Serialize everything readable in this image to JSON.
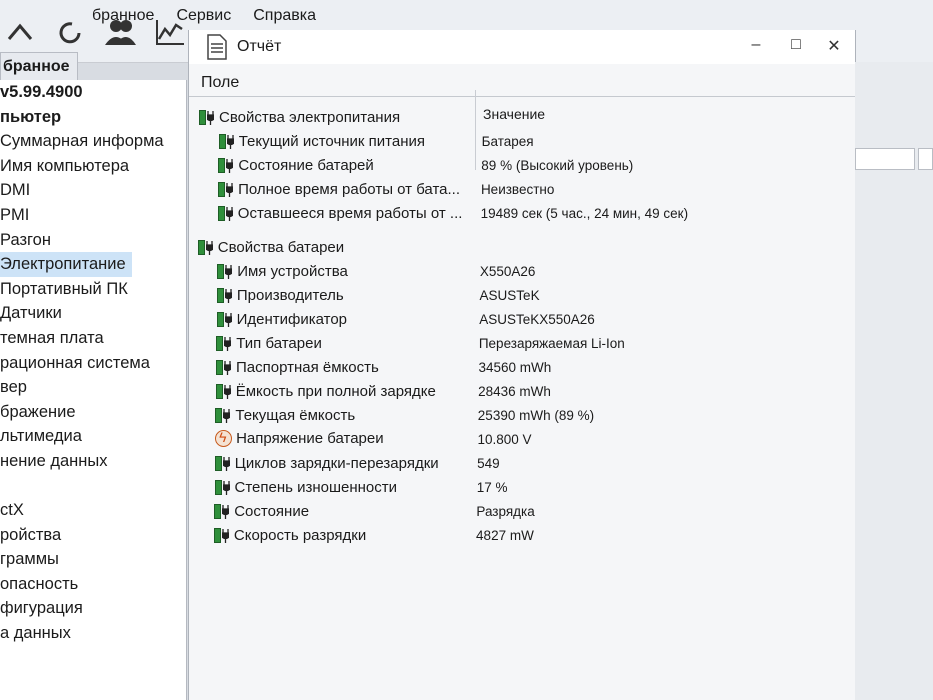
{
  "menu": {
    "favorites_partial": "бранное",
    "service": "Сервис",
    "help": "Справка"
  },
  "toolbar": {
    "icons": [
      "up-arrow-icon",
      "refresh-icon",
      "users-icon",
      "chart-icon"
    ]
  },
  "left": {
    "tab_label": "бранное",
    "tree": [
      {
        "label": "v5.99.4900",
        "bold": true
      },
      {
        "label": "пьютер",
        "bold": true
      },
      {
        "label": "Суммарная информа"
      },
      {
        "label": "Имя компьютера"
      },
      {
        "label": "DMI"
      },
      {
        "label": "PMI"
      },
      {
        "label": "Разгон"
      },
      {
        "label": "Электропитание",
        "selected": true
      },
      {
        "label": "Портативный ПК"
      },
      {
        "label": "Датчики"
      },
      {
        "label": "темная плата"
      },
      {
        "label": "рационная система"
      },
      {
        "label": "вер"
      },
      {
        "label": "бражение"
      },
      {
        "label": "льтимедиа"
      },
      {
        "label": "нение данных"
      },
      {
        "label": ""
      },
      {
        "label": "ctX"
      },
      {
        "label": "ройства"
      },
      {
        "label": "граммы"
      },
      {
        "label": "опасность"
      },
      {
        "label": "фигурация"
      },
      {
        "label": "а данных"
      }
    ]
  },
  "report": {
    "title": "Отчёт",
    "window_controls": {
      "minimize": "–",
      "maximize": "□",
      "close": "✕"
    },
    "header_field": "Поле",
    "header_value": "Значение",
    "sections": [
      {
        "title": "Свойства электропитания",
        "rows": [
          {
            "field": "Текущий источник питания",
            "value": "Батарея"
          },
          {
            "field": "Состояние батарей",
            "value": "89 % (Высокий уровень)"
          },
          {
            "field": "Полное время работы от бата...",
            "value": "Неизвестно"
          },
          {
            "field": "Оставшееся время работы от ...",
            "value": "19489 сек (5 час., 24 мин, 49 сек)"
          }
        ]
      },
      {
        "title": "Свойства батареи",
        "rows": [
          {
            "field": "Имя устройства",
            "value": "X550A26"
          },
          {
            "field": "Производитель",
            "value": "ASUSTeK"
          },
          {
            "field": "Идентификатор",
            "value": "ASUSTeKX550A26"
          },
          {
            "field": "Тип батареи",
            "value": "Перезаряжаемая Li-Ion"
          },
          {
            "field": "Паспортная ёмкость",
            "value": "34560 mWh"
          },
          {
            "field": "Ёмкость при полной зарядке",
            "value": "28436 mWh"
          },
          {
            "field": "Текущая ёмкость",
            "value": "25390 mWh  (89 %)"
          },
          {
            "field": "Напряжение батареи",
            "value": "10.800 V",
            "icon": "voltage-icon"
          },
          {
            "field": "Циклов зарядки-перезарядки",
            "value": "549"
          },
          {
            "field": "Степень изношенности",
            "value": "17 %"
          },
          {
            "field": "Состояние",
            "value": "Разрядка"
          },
          {
            "field": "Скорость разрядки",
            "value": "4827 mW"
          }
        ]
      }
    ]
  },
  "colors": {
    "battery_green": "#2f8f3b",
    "selection": "#cde3f7",
    "voltage_orange": "#d14c12"
  }
}
